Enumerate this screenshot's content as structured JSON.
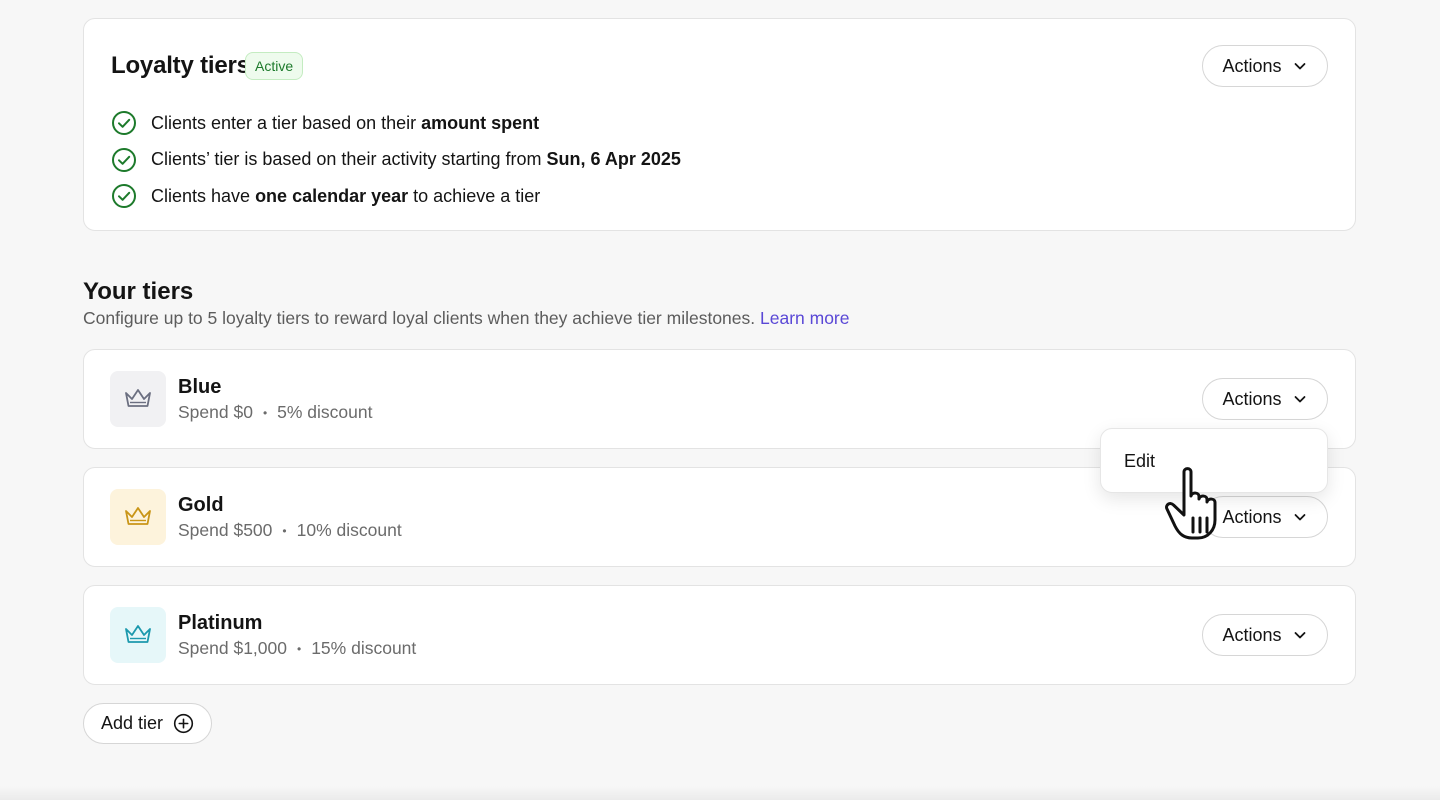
{
  "summary": {
    "title": "Loyalty tiers",
    "status_badge": "Active",
    "actions_label": "Actions",
    "rules": [
      {
        "text_before": "Clients enter a tier based on their ",
        "bold": "amount spent",
        "text_after": ""
      },
      {
        "text_before": "Clients’ tier is based on their activity starting from ",
        "bold": "Sun, 6 Apr 2025",
        "text_after": ""
      },
      {
        "text_before": "Clients have ",
        "bold": "one calendar year",
        "text_after": " to achieve a tier"
      }
    ]
  },
  "tiers_section": {
    "title": "Your tiers",
    "subtitle": "Configure up to 5 loyalty tiers to reward loyal clients when they achieve tier milestones. ",
    "learn_more": "Learn more"
  },
  "tiers": [
    {
      "name": "Blue",
      "spend": "Spend $0",
      "discount": "5% discount",
      "actions_label": "Actions",
      "icon": "crown-icon",
      "icon_color": "#6b6f80",
      "icon_bg": "#f1f1f3"
    },
    {
      "name": "Gold",
      "spend": "Spend $500",
      "discount": "10% discount",
      "actions_label": "Actions",
      "icon": "crown-icon",
      "icon_color": "#c99517",
      "icon_bg": "#fdf3dc"
    },
    {
      "name": "Platinum",
      "spend": "Spend $1,000",
      "discount": "15% discount",
      "actions_label": "Actions",
      "icon": "crown-icon",
      "icon_color": "#1c99ad",
      "icon_bg": "#e6f7f9"
    }
  ],
  "dropdown": {
    "items": [
      "Edit"
    ]
  },
  "add_tier_label": "Add tier",
  "colors": {
    "accent_link": "#5a48d6",
    "success": "#1d7a2b",
    "border": "#e3e3e3"
  }
}
